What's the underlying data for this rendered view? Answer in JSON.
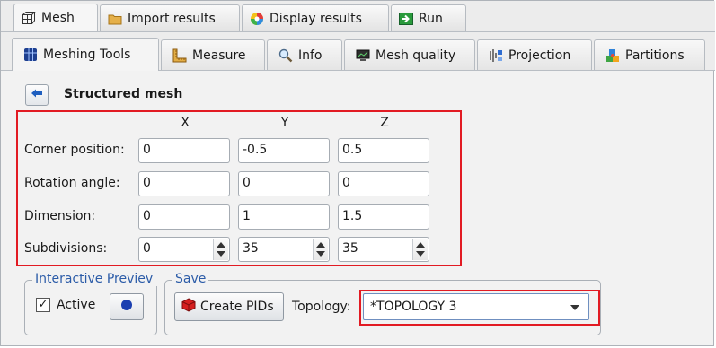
{
  "top_tabs": [
    {
      "label": "Mesh",
      "icon": "mesh-grid-icon"
    },
    {
      "label": "Import results",
      "icon": "folder-icon"
    },
    {
      "label": "Display results",
      "icon": "color-wheel-icon"
    },
    {
      "label": "Run",
      "icon": "run-arrow-icon"
    }
  ],
  "sub_tabs": [
    {
      "label": "Meshing Tools",
      "icon": "mesh-tools-icon"
    },
    {
      "label": "Measure",
      "icon": "ruler-icon"
    },
    {
      "label": "Info",
      "icon": "magnifier-icon"
    },
    {
      "label": "Mesh quality",
      "icon": "monitor-icon"
    },
    {
      "label": "Projection",
      "icon": "projection-icon"
    },
    {
      "label": "Partitions",
      "icon": "puzzle-icon"
    }
  ],
  "section": {
    "title": "Structured mesh",
    "back_icon": "back-arrow-icon"
  },
  "columns": [
    "X",
    "Y",
    "Z"
  ],
  "rows": [
    {
      "label": "Corner position:",
      "values": [
        "0",
        "-0.5",
        "0.5"
      ]
    },
    {
      "label": "Rotation angle:",
      "values": [
        "0",
        "0",
        "0"
      ]
    },
    {
      "label": "Dimension:",
      "values": [
        "0",
        "1",
        "1.5"
      ]
    },
    {
      "label": "Subdivisions:",
      "values": [
        "0",
        "35",
        "35"
      ]
    }
  ],
  "preview_group": {
    "legend": "Interactive Previev",
    "checkbox_label": "Active",
    "checked": true,
    "check_mark": "✓"
  },
  "save_group": {
    "legend": "Save",
    "create_button": "Create PIDs",
    "topology_label": "Topology:",
    "topology_value": "*TOPOLOGY 3"
  },
  "colors": {
    "highlight": "#e21b23",
    "legend_text": "#2c5ca8",
    "accent_blue": "#1f5fbf"
  }
}
